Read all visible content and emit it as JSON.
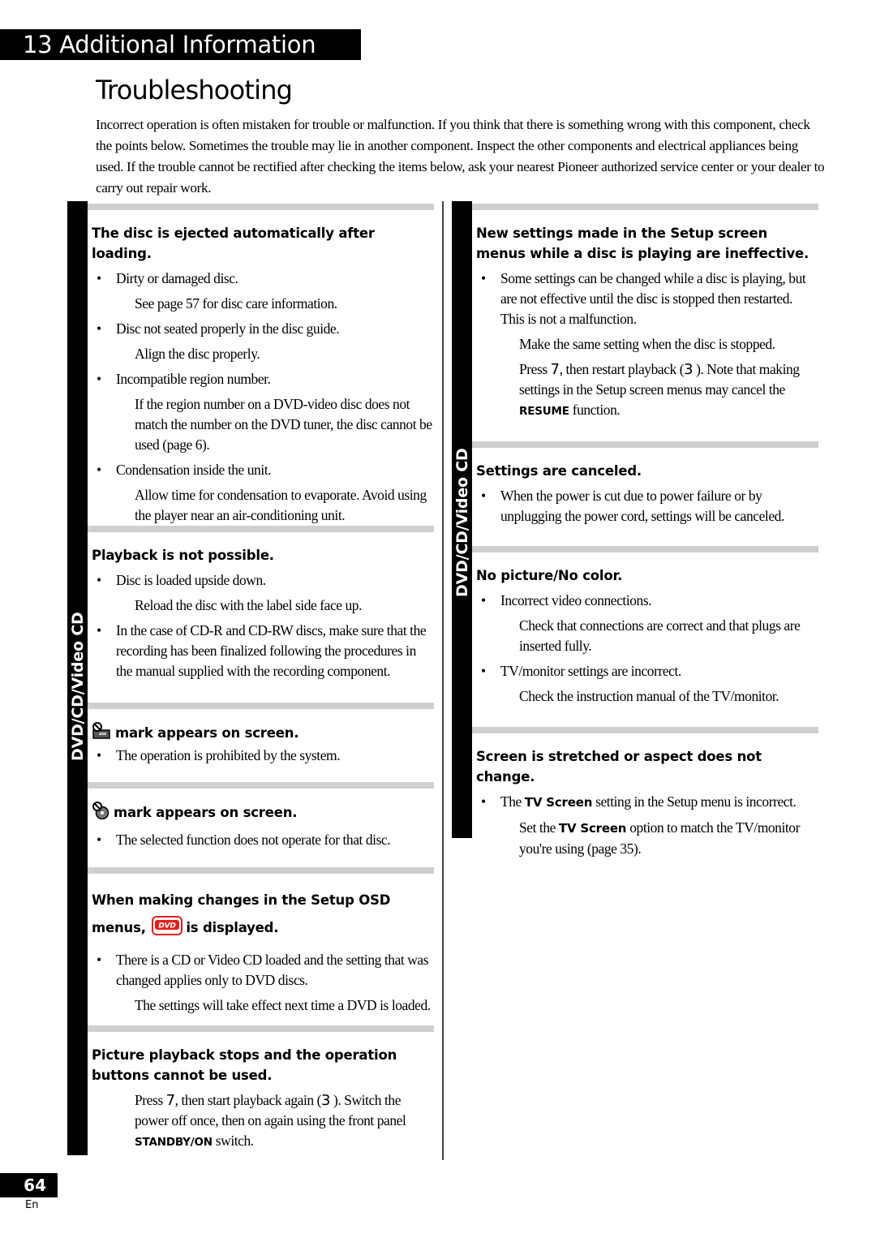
{
  "chapter": {
    "number": "13",
    "title": "Additional Information",
    "full": "13 Additional Information"
  },
  "page_title": "Troubleshooting",
  "intro": "Incorrect operation is often mistaken for trouble or malfunction. If you think that there is something wrong with this component, check the points below. Sometimes the trouble may lie in another component. Inspect the other components and electrical appliances being used. If the trouble cannot be rectified after checking the items below, ask your nearest Pioneer authorized service center or your dealer to carry out repair work.",
  "side_tab_label": "DVD/CD/Video CD",
  "left_sections": [
    {
      "title": "The disc is ejected automatically after loading.",
      "items": [
        {
          "bullet": "Dirty or damaged disc.",
          "remedy": "See page 57 for disc care information."
        },
        {
          "bullet": "Disc not seated properly in the disc guide.",
          "remedy": "Align the disc properly."
        },
        {
          "bullet": "Incompatible region number.",
          "remedy": "If the region number on a DVD-video disc does not match the number on the DVD tuner, the disc cannot be used (page 6)."
        },
        {
          "bullet": "Condensation inside the unit.",
          "remedy": "Allow time for condensation to evaporate. Avoid using the player near an air-conditioning unit."
        }
      ]
    },
    {
      "title": "Playback is not possible.",
      "items": [
        {
          "bullet": "Disc is loaded upside down.",
          "remedy": "Reload the disc with the label side face up."
        },
        {
          "bullet": "In the case of CD-R and CD-RW discs, make sure that the recording has been finalized following the procedures in the manual supplied with the recording component."
        }
      ]
    },
    {
      "title": "mark appears on screen.",
      "icon": "prohibited-hand-icon",
      "items": [
        {
          "bullet": "The operation is prohibited by the system."
        }
      ]
    },
    {
      "title": "mark appears on screen.",
      "icon": "prohibited-disc-icon",
      "items": [
        {
          "bullet": "The selected function does not operate for that disc."
        }
      ]
    },
    {
      "title_part1": "When making changes in the Setup OSD menus,",
      "title_part2": "is displayed.",
      "icon": "dvd-logo-icon",
      "icon_label": "DVD",
      "items": [
        {
          "bullet": "There is a CD or Video CD loaded and the setting that was changed applies only to DVD discs.",
          "remedy": "The settings will take effect next time a DVD is loaded."
        }
      ]
    },
    {
      "title": "Picture playback stops and the operation buttons cannot be used.",
      "remedy_parts": [
        "Press ",
        "7",
        ", then start playback again (",
        "3",
        " ). Switch the power off once, then on again using the front panel ",
        "STANDBY/ON",
        " switch."
      ]
    }
  ],
  "right_sections": [
    {
      "title": "New settings made in the Setup screen menus while a disc is playing are ineffective.",
      "bullet": "Some settings can be changed while a disc is playing, but are not effective until the disc is stopped then restarted. This is not a malfunction.",
      "remedy1": "Make the same setting when the disc is stopped.",
      "remedy2_parts": [
        "Press ",
        "7",
        ", then restart playback (",
        "3",
        " ). Note that making settings in the Setup screen menus may cancel the ",
        "RESUME",
        " function."
      ]
    },
    {
      "title": "Settings are canceled.",
      "items": [
        {
          "bullet": "When the power is cut due to power failure or by unplugging the power cord, settings will be canceled."
        }
      ]
    },
    {
      "title": "No picture/No color.",
      "items": [
        {
          "bullet": "Incorrect video connections.",
          "remedy": "Check that connections are correct and that plugs are inserted fully."
        },
        {
          "bullet": "TV/monitor settings are incorrect.",
          "remedy": "Check the instruction manual of the TV/monitor."
        }
      ]
    },
    {
      "title": "Screen is stretched or aspect does not change.",
      "bullet_parts": [
        "The ",
        "TV Screen",
        " setting in the Setup menu is incorrect."
      ],
      "remedy_parts": [
        "Set the ",
        "TV Screen",
        " option to match the TV/monitor you're using (page 35)."
      ]
    }
  ],
  "footer": {
    "page_number": "64",
    "language": "En"
  },
  "colors": {
    "rule": "#cfcfcf",
    "tab": "#000000",
    "dvd_logo": "#e0201a"
  }
}
